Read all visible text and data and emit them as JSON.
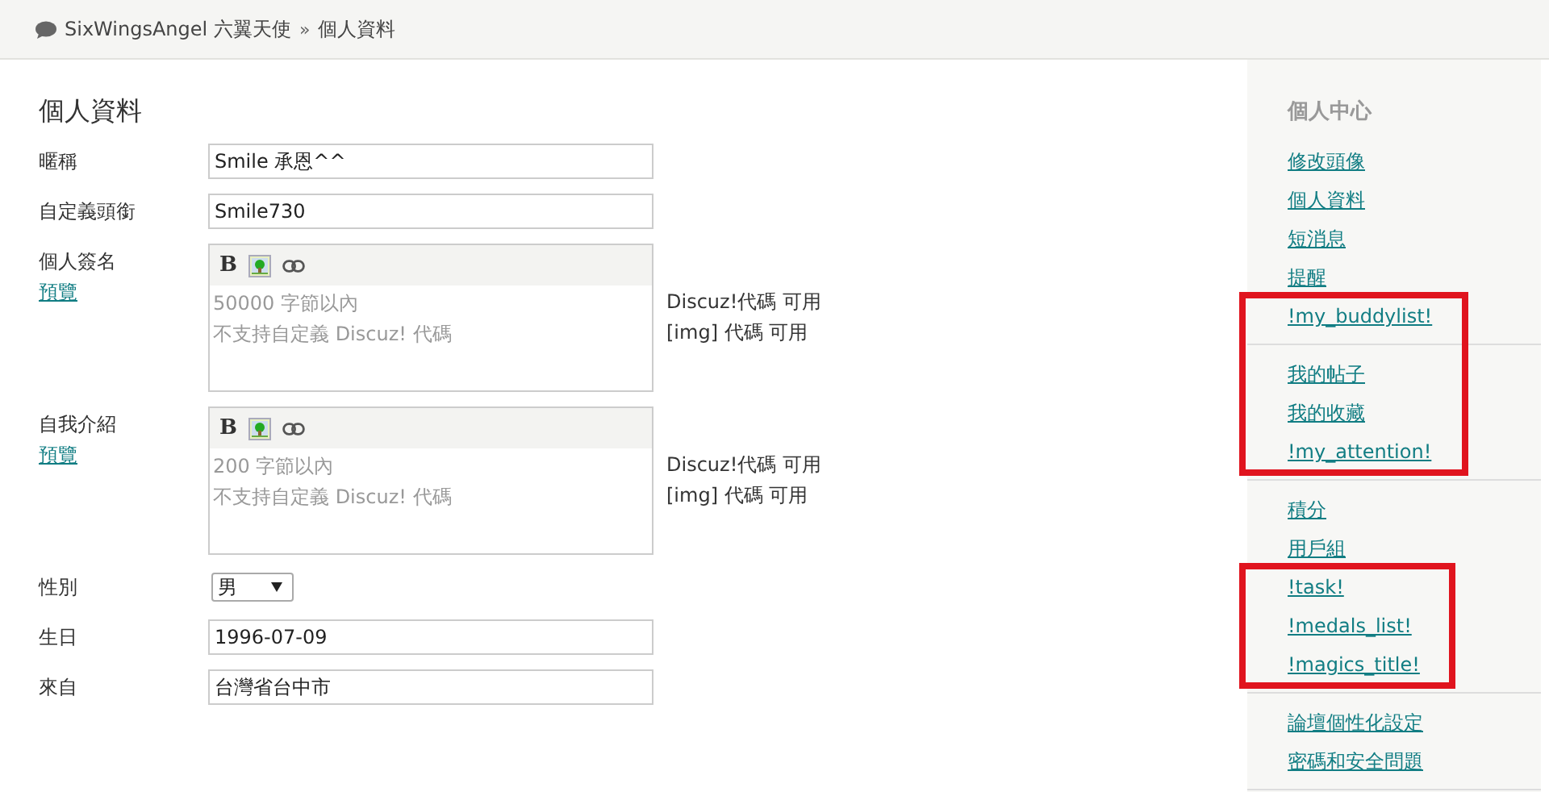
{
  "breadcrumb": {
    "site": "SixWingsAngel 六翼天使",
    "separator": "»",
    "current": "個人資料"
  },
  "form": {
    "title": "個人資料",
    "fields": [
      {
        "kind": "text",
        "label": "暱稱",
        "value": "Smile 承恩^^"
      },
      {
        "kind": "text",
        "label": "自定義頭銜",
        "value": "Smile730"
      },
      {
        "kind": "editor",
        "label": "個人簽名",
        "preview": "預覽",
        "bold": "B",
        "placeholder_lines": [
          "50000 字節以內",
          "不支持自定義 Discuz! 代碼"
        ],
        "notes": [
          "Discuz!代碼 可用",
          "[img] 代碼 可用"
        ]
      },
      {
        "kind": "editor",
        "label": "自我介紹",
        "preview": "預覽",
        "bold": "B",
        "placeholder_lines": [
          "200 字節以內",
          "不支持自定義 Discuz! 代碼"
        ],
        "notes": [
          "Discuz!代碼 可用",
          "[img] 代碼 可用"
        ]
      },
      {
        "kind": "select",
        "label": "性別",
        "value": "男"
      },
      {
        "kind": "text",
        "label": "生日",
        "value": "1996-07-09"
      },
      {
        "kind": "text",
        "label": "來自",
        "value": "台灣省台中市"
      }
    ]
  },
  "sidebar": {
    "title": "個人中心",
    "groups": [
      {
        "items": [
          {
            "label": "修改頭像",
            "highlighted": false
          },
          {
            "label": "個人資料",
            "highlighted": false
          },
          {
            "label": "短消息",
            "highlighted": false
          },
          {
            "label": "提醒",
            "highlighted": false
          },
          {
            "label": "!my_buddylist!",
            "highlighted": true
          }
        ]
      },
      {
        "items": [
          {
            "label": "我的帖子",
            "highlighted": true
          },
          {
            "label": "我的收藏",
            "highlighted": true
          },
          {
            "label": "!my_attention!",
            "highlighted": true
          }
        ]
      },
      {
        "items": [
          {
            "label": "積分",
            "highlighted": false
          },
          {
            "label": "用戶組",
            "highlighted": false
          },
          {
            "label": "!task!",
            "highlighted": true
          },
          {
            "label": "!medals_list!",
            "highlighted": true
          },
          {
            "label": "!magics_title!",
            "highlighted": true
          }
        ]
      },
      {
        "items": [
          {
            "label": "論壇個性化設定",
            "highlighted": false
          },
          {
            "label": "密碼和安全問題",
            "highlighted": false
          }
        ]
      }
    ]
  }
}
